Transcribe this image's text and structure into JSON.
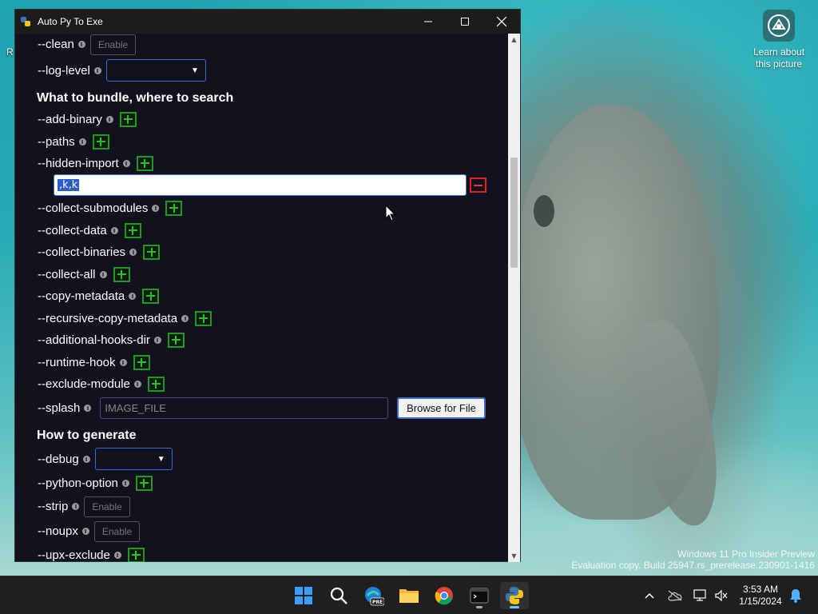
{
  "window": {
    "title": "Auto Py To Exe"
  },
  "options": {
    "clean": {
      "label": "--clean",
      "toggle": "Enable"
    },
    "log_level": {
      "label": "--log-level",
      "value": ""
    },
    "section_bundle": "What to bundle, where to search",
    "add_binary": "--add-binary",
    "paths": "--paths",
    "hidden_import": {
      "label": "--hidden-import",
      "value": ",k,k"
    },
    "collect_submodules": "--collect-submodules",
    "collect_data": "--collect-data",
    "collect_binaries": "--collect-binaries",
    "collect_all": "--collect-all",
    "copy_metadata": "--copy-metadata",
    "recursive_copy_metadata": "--recursive-copy-metadata",
    "additional_hooks_dir": "--additional-hooks-dir",
    "runtime_hook": "--runtime-hook",
    "exclude_module": "--exclude-module",
    "splash": {
      "label": "--splash",
      "placeholder": "IMAGE_FILE",
      "browse": "Browse for File"
    },
    "section_generate": "How to generate",
    "debug": {
      "label": "--debug",
      "value": ""
    },
    "python_option": "--python-option",
    "strip": {
      "label": "--strip",
      "toggle": "Enable"
    },
    "noupx": {
      "label": "--noupx",
      "toggle": "Enable"
    },
    "upx_exclude": "--upx-exclude"
  },
  "desktop": {
    "icon_label_line1": "Learn about",
    "icon_label_line2": "this picture",
    "left_fragment": "R",
    "watermark_line1": "Windows 11 Pro Insider Preview",
    "watermark_line2": "Evaluation copy. Build 25947.rs_prerelease.230901-1416"
  },
  "taskbar": {
    "icons": [
      "windows-start-icon",
      "search-icon",
      "edge-pre-icon",
      "file-explorer-icon",
      "chrome-icon",
      "terminal-icon",
      "python-icon"
    ],
    "edge_badge": "PRE",
    "time": "3:53 AM",
    "date": "1/15/2024"
  },
  "colors": {
    "accent": "#3c6bd0",
    "plus": "#22c522",
    "minus": "#e33333",
    "window_bg": "#12121f"
  }
}
